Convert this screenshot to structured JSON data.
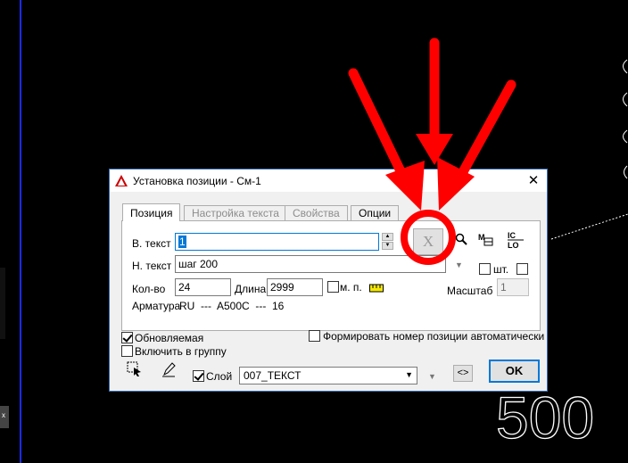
{
  "window": {
    "title": "Установка позиции - См-1",
    "close_glyph": "✕"
  },
  "tabs": [
    {
      "label": "Позиция"
    },
    {
      "label": "Настройка текста"
    },
    {
      "label": "Свойства"
    },
    {
      "label": "Опции"
    }
  ],
  "form": {
    "top_text_label": "В. текст",
    "top_text_value": "1",
    "bottom_text_label": "Н. текст",
    "bottom_text_value": "шаг 200",
    "count_label": "Кол-во",
    "count_value": "24",
    "length_label": "Длина",
    "length_value": "2999",
    "mp_label": "м. п.",
    "pcs_label": "шт.",
    "scale_label": "Масштаб",
    "scale_value": "1",
    "rebar_label": "Арматура",
    "rebar_value": "RU  ---  A500C  ---  16"
  },
  "options": {
    "updatable_label": "Обновляемая",
    "group_label": "Включить в группу",
    "auto_number_label": "Формировать номер позиции автоматически",
    "layer_label": "Слой",
    "layer_value": "007_ТЕКСТ",
    "code_glyph": "<>",
    "ok_label": "OK"
  },
  "icons": {
    "clear": "X",
    "zoom": "🔍",
    "updown": "▲▼",
    "arrow_down": "▼"
  },
  "background": {
    "cad_text": "500"
  },
  "colors": {
    "accent": "#0078d7",
    "annotation": "#ff0000"
  }
}
